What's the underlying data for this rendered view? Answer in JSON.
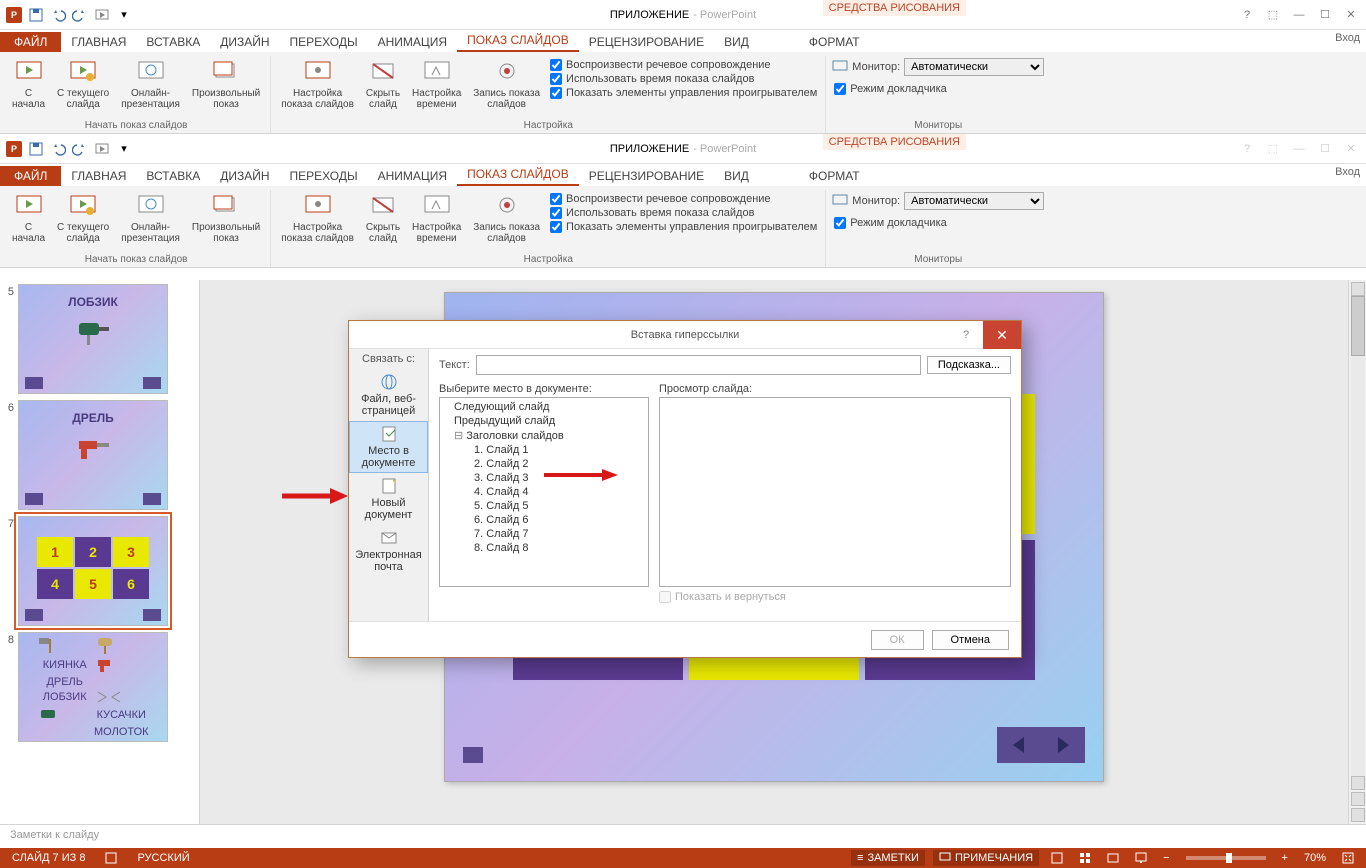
{
  "app": {
    "doc_title": "ПРИЛОЖЕНИЕ",
    "app_name": "- PowerPoint",
    "context_group": "СРЕДСТВА РИСОВАНИЯ",
    "signin": "Вход"
  },
  "tabs": {
    "file": "ФАЙЛ",
    "home": "ГЛАВНАЯ",
    "insert": "ВСТАВКА",
    "design": "ДИЗАЙН",
    "transitions": "ПЕРЕХОДЫ",
    "animations": "АНИМАЦИЯ",
    "slideshow": "ПОКАЗ СЛАЙДОВ",
    "review": "РЕЦЕНЗИРОВАНИЕ",
    "view": "ВИД",
    "format": "ФОРМАТ"
  },
  "ribbon": {
    "from_start": "С\nначала",
    "from_current": "С текущего\nслайда",
    "online": "Онлайн-\nпрезентация",
    "custom": "Произвольный\nпоказ",
    "grp_start": "Начать показ слайдов",
    "setup": "Настройка\nпоказа слайдов",
    "hide": "Скрыть\nслайд",
    "rehearse": "Настройка\nвремени",
    "record": "Запись показа\nслайдов",
    "chk_narr": "Воспроизвести речевое сопровождение",
    "chk_timings": "Использовать время показа слайдов",
    "chk_media": "Показать элементы управления проигрывателем",
    "grp_setup": "Настройка",
    "monitor": "Монитор:",
    "monitor_val": "Автоматически",
    "presenter": "Режим докладчика",
    "grp_monitors": "Мониторы"
  },
  "thumbs": {
    "t5": {
      "title": "ЛОБЗИК"
    },
    "t6": {
      "title": "ДРЕЛЬ"
    },
    "t7": {},
    "t8": {
      "l1": "КИЯНКА",
      "l2": "ДРЕЛЬ",
      "l3": "ЛОБЗИК",
      "l4": "КУСАЧКИ",
      "l5": "МОЛОТОК"
    }
  },
  "grid": [
    "1",
    "2",
    "3",
    "4",
    "5",
    "6"
  ],
  "dialog": {
    "title": "Вставка гиперссылки",
    "linkwith": "Связать с:",
    "text_label": "Текст:",
    "tip": "Подсказка...",
    "side": {
      "file": "Файл, веб-страницей",
      "place": "Место в документе",
      "newdoc": "Новый документ",
      "email": "Электронная почта"
    },
    "tree_label": "Выберите место в документе:",
    "preview_label": "Просмотр слайда:",
    "tree": {
      "next": "Следующий слайд",
      "prev": "Предыдущий слайд",
      "headers": "Заголовки слайдов",
      "s1": "1. Слайд 1",
      "s2": "2. Слайд 2",
      "s3": "3. Слайд 3",
      "s4": "4. Слайд 4",
      "s5": "5. Слайд 5",
      "s6": "6. Слайд 6",
      "s7": "7. Слайд 7",
      "s8": "8. Слайд 8"
    },
    "show_return": "Показать и вернуться",
    "ok": "ОК",
    "cancel": "Отмена"
  },
  "notes": "Заметки к слайду",
  "status": {
    "slide": "СЛАЙД 7 ИЗ 8",
    "lang": "РУССКИЙ",
    "notes": "ЗАМЕТКИ",
    "comments": "ПРИМЕЧАНИЯ",
    "zoom": "70%"
  }
}
